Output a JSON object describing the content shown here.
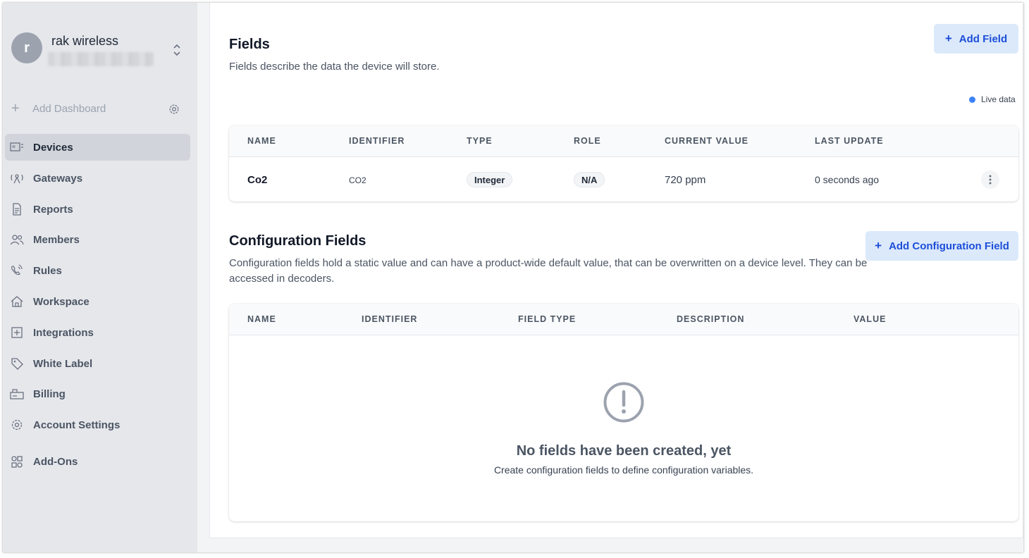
{
  "account": {
    "initial": "r",
    "name": "rak wireless",
    "email": "redacted"
  },
  "sidebar": {
    "add_dashboard": "Add Dashboard",
    "items": [
      {
        "label": "Devices",
        "icon": "devices-icon",
        "active": true
      },
      {
        "label": "Gateways",
        "icon": "gateway-icon"
      },
      {
        "label": "Reports",
        "icon": "report-icon"
      },
      {
        "label": "Members",
        "icon": "members-icon"
      },
      {
        "label": "Rules",
        "icon": "rules-icon"
      },
      {
        "label": "Workspace",
        "icon": "workspace-icon"
      },
      {
        "label": "Integrations",
        "icon": "integrations-icon"
      },
      {
        "label": "White Label",
        "icon": "tag-icon"
      },
      {
        "label": "Billing",
        "icon": "billing-icon"
      },
      {
        "label": "Account Settings",
        "icon": "gear-icon"
      },
      {
        "label": "Add-Ons",
        "icon": "addons-icon"
      }
    ]
  },
  "fields": {
    "title": "Fields",
    "description": "Fields describe the data the device will store.",
    "add_button": "Add Field",
    "live_label": "Live data",
    "columns": [
      "NAME",
      "IDENTIFIER",
      "TYPE",
      "ROLE",
      "CURRENT VALUE",
      "LAST UPDATE"
    ],
    "rows": [
      {
        "name": "Co2",
        "identifier": "CO2",
        "type": "Integer",
        "role": "N/A",
        "current_value": "720 ppm",
        "last_update": "0 seconds ago"
      }
    ]
  },
  "config": {
    "title": "Configuration Fields",
    "description": "Configuration fields hold a static value and can have a product-wide default value, that can be overwritten on a device level. They can be accessed in decoders.",
    "add_button": "Add Configuration Field",
    "columns": [
      "NAME",
      "IDENTIFIER",
      "FIELD TYPE",
      "DESCRIPTION",
      "VALUE"
    ],
    "empty_title": "No fields have been created, yet",
    "empty_desc": "Create configuration fields to define configuration variables."
  },
  "colors": {
    "accent": "#1d4ed8",
    "button_bg": "#dbe9fb",
    "live_dot": "#3b82f6",
    "sidebar_bg": "#e5e7eb"
  }
}
